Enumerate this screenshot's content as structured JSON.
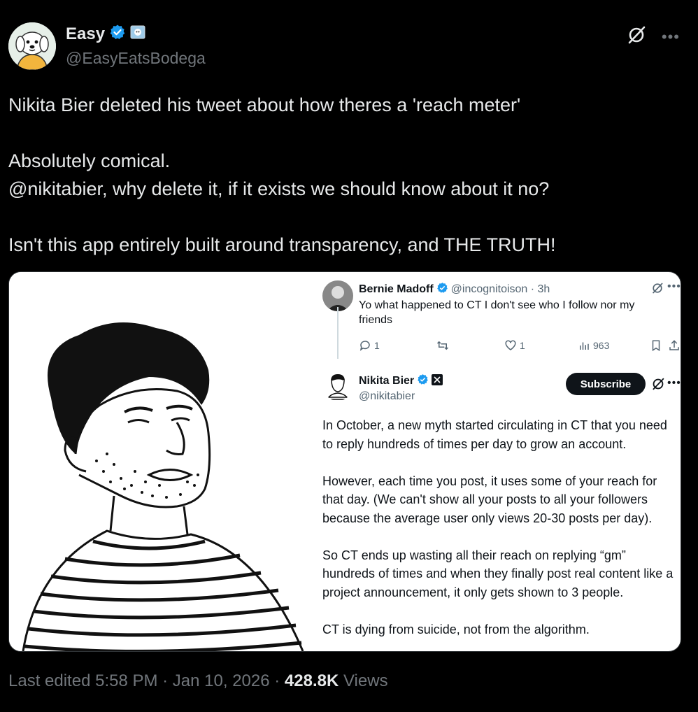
{
  "post": {
    "display_name": "Easy",
    "handle": "@EasyEatsBodega",
    "text": "Nikita Bier deleted his tweet about how theres a 'reach meter'\n\nAbsolutely comical.\n@nikitabier, why delete it, if it exists we should know about it no?\n\nIsn't this app entirely built around transparency, and THE TRUTH!",
    "footer": {
      "edited": "Last edited 5:58 PM · Jan 10, 2026 · ",
      "views_count": "428.8K",
      "views_label": " Views"
    }
  },
  "quoted_reply": {
    "name": "Bernie Madoff",
    "handle": "@incognitoison · 3h",
    "text": "Yo what happened to CT I don't see who I follow nor my friends",
    "actions": {
      "replies": "1",
      "reposts": "",
      "likes": "1",
      "views": "963"
    }
  },
  "quoted_post": {
    "name": "Nikita Bier",
    "handle": "@nikitabier",
    "subscribe_label": "Subscribe",
    "text": "In October, a new myth started circulating in CT that you need to reply hundreds of times per day to grow an account.\n\nHowever, each time you post, it uses some of your reach for that day. (We can't show all your posts to all your followers because the average user only views 20-30 posts per day).\n\nSo CT ends up wasting all their reach on replying “gm” hundreds of times and when they finally post real content like a project announcement, it only gets shown to 3 people.\n\nCT is dying from suicide, not from the algorithm."
  },
  "colors": {
    "background": "#000000",
    "text": "#e7e9ea",
    "muted": "#71767b",
    "verified": "#1d9bf0"
  },
  "icons": [
    "verified-badge-icon",
    "affiliate-badge-icon",
    "grok-icon",
    "more-icon",
    "reply-icon",
    "repost-icon",
    "like-icon",
    "views-icon",
    "bookmark-icon",
    "share-icon",
    "x-logo-icon"
  ]
}
